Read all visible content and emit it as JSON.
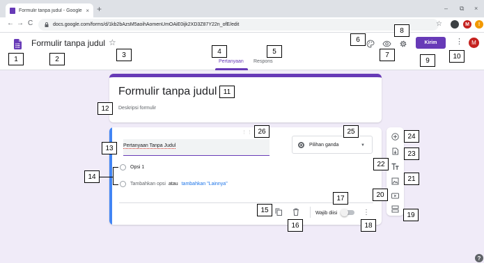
{
  "browser": {
    "tab_title": "Formulir tanpa judul - Google Fo",
    "tab_close": "×",
    "new_tab": "+",
    "url": "docs.google.com/forms/d/1kb2bAzsM5aoihAomenUmOAiE0ijk2XD3Z87Y22n_ofE/edit",
    "back": "←",
    "forward": "→",
    "reload": "C",
    "minimize": "–",
    "restore": "⧉",
    "close": "×",
    "bookmark_star": "☆",
    "profile_initial": "M",
    "warn_glyph": "!",
    "lock": "🔒"
  },
  "header": {
    "form_title": "Formulir tanpa judul",
    "tabs": [
      {
        "label": "Pertanyaan",
        "active": true
      },
      {
        "label": "Respons",
        "active": false
      }
    ],
    "send_label": "Kirim",
    "more_glyph": "⋮",
    "avatar_initial": "M",
    "star_glyph": "☆"
  },
  "title_card": {
    "heading": "Formulir tanpa judul",
    "description": "Deskripsi formulir"
  },
  "question": {
    "title": "Pertanyaan Tanpa Judul",
    "type": "Pilihan ganda",
    "options": [
      {
        "label": "Opsi 1"
      }
    ],
    "add_option": "Tambahkan opsi",
    "add_option_or": "atau",
    "add_other": "tambahkan \"Lainnya\"",
    "required_label": "Wajib diisi",
    "required": false,
    "drag_glyph": "⋮⋮⋮",
    "more_glyph": "⋮"
  },
  "help_glyph": "?",
  "annotations": [
    "1",
    "2",
    "3",
    "4",
    "5",
    "6",
    "7",
    "8",
    "9",
    "10",
    "11",
    "12",
    "13",
    "14",
    "15",
    "16",
    "17",
    "18",
    "19",
    "20",
    "21",
    "22",
    "23",
    "24",
    "25",
    "26"
  ],
  "icons": {
    "form": "form-doc-icon",
    "palette": "palette-icon",
    "preview": "eye-icon",
    "settings": "gear-icon",
    "duplicate": "copy-icon",
    "delete": "trash-icon",
    "add_question": "add-circle-icon",
    "import": "import-icon",
    "title_text": "text-title-icon",
    "image": "image-icon",
    "video": "video-icon",
    "section": "section-icon"
  },
  "colors": {
    "accent": "#673ab7",
    "canvas": "#f0ebf8",
    "active_bar": "#4285f4",
    "link": "#1a73e8",
    "avatar": "#c5221f"
  }
}
